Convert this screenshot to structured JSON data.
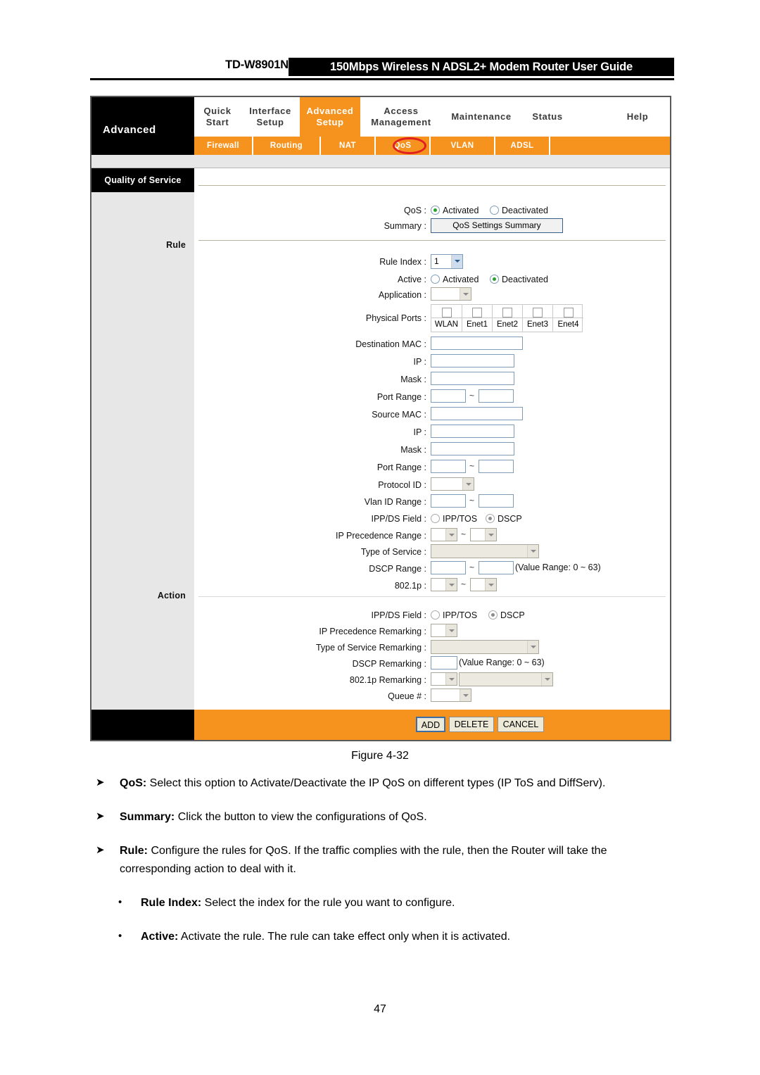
{
  "document": {
    "model": "TD-W8901N",
    "title": "150Mbps Wireless N ADSL2+ Modem Router User Guide",
    "figure_caption": "Figure 4-32",
    "page_number": "47"
  },
  "router_ui": {
    "brand_label": "Advanced",
    "section_title": "Quality of Service",
    "main_nav": [
      {
        "label_line1": "Quick",
        "label_line2": "Start",
        "active": false
      },
      {
        "label_line1": "Interface",
        "label_line2": "Setup",
        "active": false
      },
      {
        "label_line1": "Advanced",
        "label_line2": "Setup",
        "active": true
      },
      {
        "label_line1": "Access",
        "label_line2": "Management",
        "active": false
      },
      {
        "label_line1": "Maintenance",
        "label_line2": "",
        "active": false
      },
      {
        "label_line1": "Status",
        "label_line2": "",
        "active": false
      },
      {
        "label_line1": "Help",
        "label_line2": "",
        "active": false
      }
    ],
    "sub_nav": [
      {
        "label": "Firewall",
        "highlighted": false
      },
      {
        "label": "Routing",
        "highlighted": false
      },
      {
        "label": "NAT",
        "highlighted": false
      },
      {
        "label": "QoS",
        "highlighted": true
      },
      {
        "label": "VLAN",
        "highlighted": false
      },
      {
        "label": "ADSL",
        "highlighted": false
      }
    ],
    "rail_labels": {
      "rule": "Rule",
      "action": "Action"
    },
    "qos": {
      "label": "QoS :",
      "option_activated": "Activated",
      "option_deactivated": "Deactivated",
      "selected": "Activated"
    },
    "summary": {
      "label": "Summary :",
      "button_label": "QoS Settings Summary"
    },
    "rule": {
      "rule_index": {
        "label": "Rule Index :",
        "value": "1"
      },
      "active": {
        "label": "Active :",
        "option_activated": "Activated",
        "option_deactivated": "Deactivated",
        "selected": "Deactivated"
      },
      "application": {
        "label": "Application :",
        "value": ""
      },
      "physical_ports": {
        "label": "Physical Ports :",
        "ports": [
          {
            "name": "WLAN",
            "checked": false
          },
          {
            "name": "Enet1",
            "checked": false
          },
          {
            "name": "Enet2",
            "checked": false
          },
          {
            "name": "Enet3",
            "checked": false
          },
          {
            "name": "Enet4",
            "checked": false
          }
        ]
      },
      "destination_mac": {
        "label": "Destination MAC :",
        "value": ""
      },
      "destination_ip": {
        "label": "IP :",
        "value": ""
      },
      "destination_mask": {
        "label": "Mask :",
        "value": ""
      },
      "destination_port_range": {
        "label": "Port Range :",
        "from": "",
        "to": "",
        "separator": "~"
      },
      "source_mac": {
        "label": "Source MAC :",
        "value": ""
      },
      "source_ip": {
        "label": "IP :",
        "value": ""
      },
      "source_mask": {
        "label": "Mask :",
        "value": ""
      },
      "source_port_range": {
        "label": "Port Range :",
        "from": "",
        "to": "",
        "separator": "~"
      },
      "protocol_id": {
        "label": "Protocol ID :",
        "value": ""
      },
      "vlan_id_range": {
        "label": "Vlan ID Range :",
        "from": "",
        "to": "",
        "separator": "~"
      },
      "ippds_field": {
        "label": "IPP/DS Field :",
        "option_ipp_tos": "IPP/TOS",
        "option_dscp": "DSCP",
        "selected": "DSCP"
      },
      "ip_precedence_range": {
        "label": "IP Precedence Range :",
        "from": "",
        "to": "",
        "separator": "~"
      },
      "type_of_service": {
        "label": "Type of Service :",
        "value": ""
      },
      "dscp_range": {
        "label": "DSCP Range :",
        "from": "",
        "to": "",
        "separator": "~",
        "hint": "(Value Range: 0 ~ 63)"
      },
      "dot1p": {
        "label": "802.1p :",
        "from": "",
        "to": "",
        "separator": "~"
      }
    },
    "action": {
      "ippds_field": {
        "label": "IPP/DS Field :",
        "option_ipp_tos": "IPP/TOS",
        "option_dscp": "DSCP",
        "selected": "DSCP"
      },
      "ip_precedence_remarking": {
        "label": "IP Precedence Remarking :",
        "value": ""
      },
      "type_of_service_remarking": {
        "label": "Type of Service Remarking :",
        "value": ""
      },
      "dscp_remarking": {
        "label": "DSCP Remarking :",
        "value": "",
        "hint": "(Value Range: 0 ~ 63)"
      },
      "dot1p_remarking": {
        "label": "802.1p Remarking :",
        "value": "",
        "value2": ""
      },
      "queue": {
        "label": "Queue # :",
        "value": ""
      }
    },
    "footer_buttons": [
      {
        "label": "ADD",
        "primary": true
      },
      {
        "label": "DELETE",
        "primary": false
      },
      {
        "label": "CANCEL",
        "primary": false
      }
    ]
  },
  "body_text": {
    "b1_mark": "➤",
    "b1_term": "QoS:",
    "b1_text": " Select this option to Activate/Deactivate the IP QoS on different types (IP ToS and DiffServ).",
    "b2_mark": "➤",
    "b2_term": "Summary:",
    "b2_text": " Click the button to view the configurations of QoS.",
    "b3_mark": "➤",
    "b3_term": "Rule:",
    "b3_text": " Configure the rules for QoS. If the traffic complies with the rule, then the Router will take the corresponding action to deal with it.",
    "b4_mark": "•",
    "b4_term": "Rule Index:",
    "b4_text": " Select the index for the rule you want to configure.",
    "b5_mark": "•",
    "b5_term": "Active:",
    "b5_text": " Activate the rule. The rule can take effect only when it is activated."
  },
  "colors": {
    "accent_orange": "#f6921e",
    "highlight_red": "#e02020",
    "rail_grey": "#e7e7e7",
    "input_border": "#7f9db9"
  }
}
